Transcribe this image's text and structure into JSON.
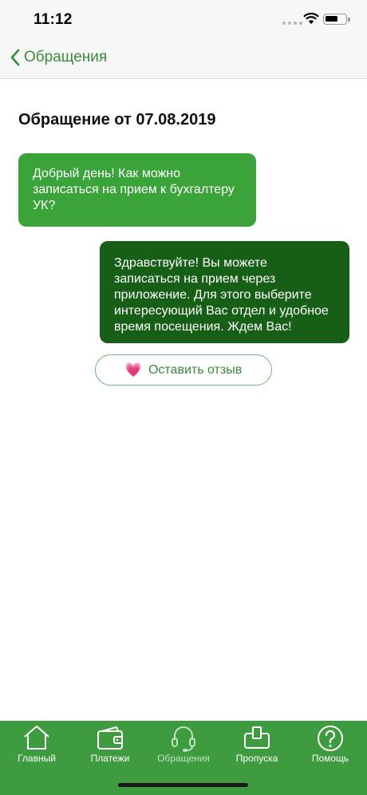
{
  "status_bar": {
    "time": "11:12"
  },
  "nav": {
    "back_label": "Обращения"
  },
  "page": {
    "title": "Обращение от 07.08.2019"
  },
  "messages": [
    {
      "direction": "incoming",
      "text": "Добрый день! Как можно записаться на прием к бухгалтеру УК?",
      "color": "#3aa33a"
    },
    {
      "direction": "outgoing",
      "text": "Здравствуйте! Вы можете записаться на прием через приложение. Для этого выберите интересующий Вас отдел и удобное время посещения. Ждем Вас!",
      "color": "#175e17"
    }
  ],
  "review_button": {
    "icon": "heart-icon",
    "label": "Оставить отзыв"
  },
  "tab_bar": {
    "background": "#3f9b3f",
    "items": [
      {
        "label": "Главный",
        "icon": "home-icon",
        "active": false
      },
      {
        "label": "Платежи",
        "icon": "wallet-icon",
        "active": false
      },
      {
        "label": "Обращения",
        "icon": "headset-icon",
        "active": true
      },
      {
        "label": "Пропуска",
        "icon": "pass-icon",
        "active": false
      },
      {
        "label": "Помощь",
        "icon": "help-icon",
        "active": false
      }
    ]
  },
  "colors": {
    "accent": "#3a8a3a"
  }
}
